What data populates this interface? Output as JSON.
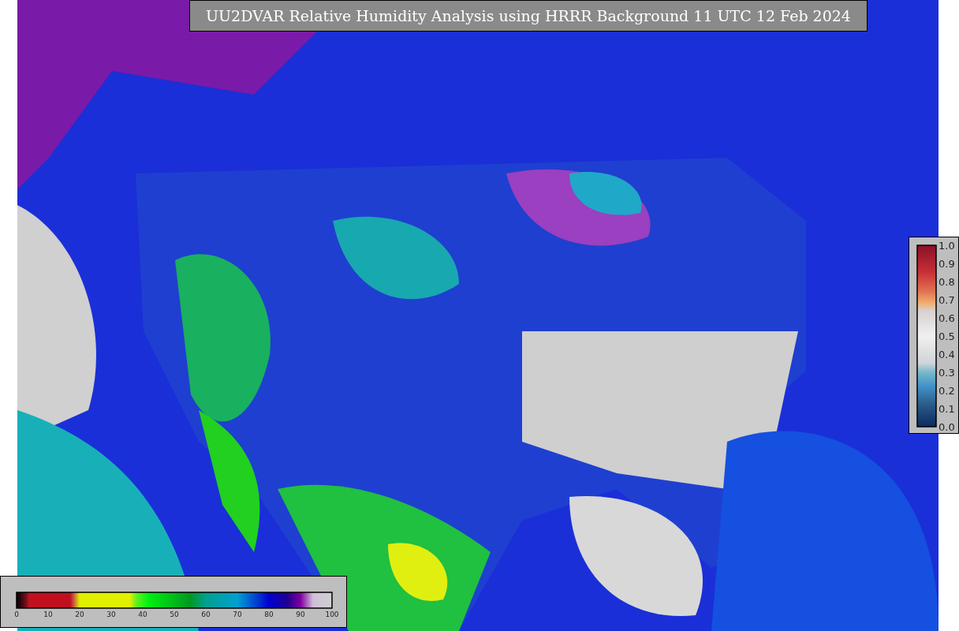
{
  "title": "UU2DVAR Relative Humidity Analysis using HRRR Background 11 UTC 12 Feb 2024",
  "humidity_colorbar": {
    "ticks": [
      "0",
      "10",
      "20",
      "30",
      "40",
      "50",
      "60",
      "70",
      "80",
      "90",
      "100"
    ]
  },
  "observation_colorbar": {
    "ticks": [
      "1.0",
      "0.9",
      "0.8",
      "0.7",
      "0.6",
      "0.5",
      "0.4",
      "0.3",
      "0.2",
      "0.1",
      "0.0"
    ]
  }
}
